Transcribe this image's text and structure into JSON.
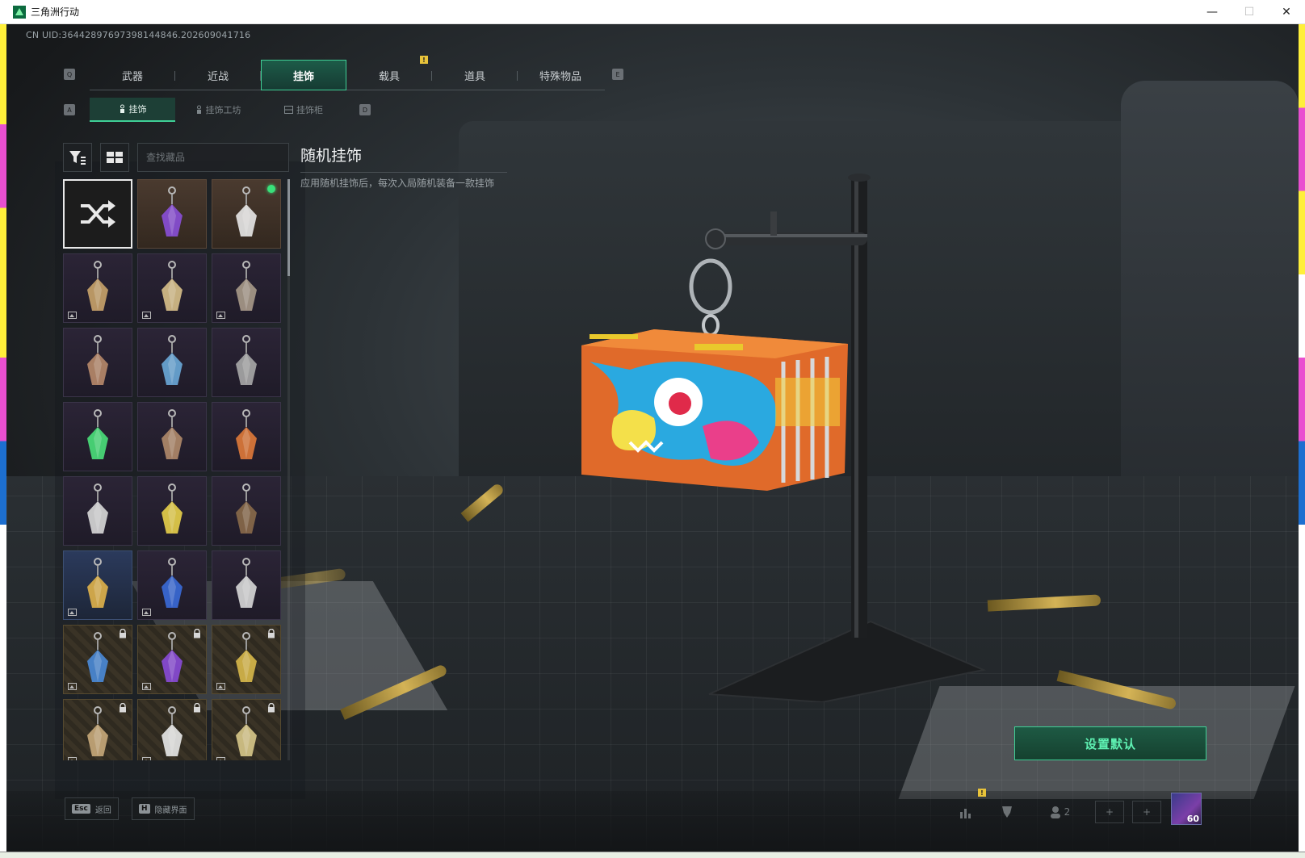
{
  "window": {
    "title": "三角洲行动"
  },
  "uid": "CN UID:36442897697398144846.202609041716",
  "main_tabs": [
    {
      "label": "武器"
    },
    {
      "label": "近战"
    },
    {
      "label": "挂饰",
      "active": true
    },
    {
      "label": "载具"
    },
    {
      "label": "道具"
    },
    {
      "label": "特殊物品"
    }
  ],
  "main_tab_keys": {
    "prev": "Q",
    "next": "E"
  },
  "sub_tabs": [
    {
      "label": "挂饰",
      "active": true
    },
    {
      "label": "挂饰工坊"
    },
    {
      "label": "挂饰柜"
    }
  ],
  "sub_tab_keys": {
    "prev": "A",
    "next": "D"
  },
  "search": {
    "placeholder": "查找藏品"
  },
  "detail": {
    "title": "随机挂饰",
    "description": "应用随机挂饰后，每次入局随机装备一款挂饰"
  },
  "set_default_label": "设置默认",
  "hints": [
    {
      "key": "Esc",
      "label": "返回"
    },
    {
      "key": "H",
      "label": "隐藏界面"
    }
  ],
  "hud": {
    "friends_count": "2",
    "level": "60"
  },
  "colors": {
    "accent": "#3fcf96",
    "accent_text": "#5ff2b3",
    "equipped_dot": "#39e07a"
  },
  "grid_items": [
    {
      "type": "random",
      "selected": true
    },
    {
      "type": "charm",
      "tier": "bronze",
      "icon": "purple-crystal-icon"
    },
    {
      "type": "charm",
      "tier": "bronze",
      "icon": "rocket-icon",
      "equipped": true
    },
    {
      "type": "charm",
      "tier": "purple",
      "icon": "hand-icon",
      "has_preview": true
    },
    {
      "type": "charm",
      "tier": "purple",
      "icon": "tag-icon",
      "has_preview": true
    },
    {
      "type": "charm",
      "tier": "purple",
      "icon": "card-icon",
      "has_preview": true
    },
    {
      "type": "charm",
      "tier": "purple",
      "icon": "boot-icon"
    },
    {
      "type": "charm",
      "tier": "purple",
      "icon": "house-icon"
    },
    {
      "type": "charm",
      "tier": "purple",
      "icon": "glove-icon"
    },
    {
      "type": "charm",
      "tier": "purple",
      "icon": "green-number-icon"
    },
    {
      "type": "charm",
      "tier": "purple",
      "icon": "frame-icon"
    },
    {
      "type": "charm",
      "tier": "purple",
      "icon": "container-icon"
    },
    {
      "type": "charm",
      "tier": "purple",
      "icon": "hat-icon"
    },
    {
      "type": "charm",
      "tier": "purple",
      "icon": "battery-icon"
    },
    {
      "type": "charm",
      "tier": "purple",
      "icon": "rifle-icon"
    },
    {
      "type": "charm",
      "tier": "blue",
      "icon": "gold-spinner-icon",
      "has_preview": true
    },
    {
      "type": "charm",
      "tier": "purple",
      "icon": "orb-icon",
      "has_preview": true
    },
    {
      "type": "charm",
      "tier": "purple",
      "icon": "figure-icon"
    },
    {
      "type": "charm",
      "tier": "gold",
      "icon": "robot-icon",
      "locked": true,
      "has_preview": true
    },
    {
      "type": "charm",
      "tier": "gold",
      "icon": "purple-coin-icon",
      "locked": true,
      "has_preview": true
    },
    {
      "type": "charm",
      "tier": "gold",
      "icon": "trophy-icon",
      "locked": true,
      "has_preview": true
    },
    {
      "type": "charm",
      "tier": "gold",
      "icon": "dragon-icon",
      "locked": true,
      "has_preview": true
    },
    {
      "type": "charm",
      "tier": "gold",
      "icon": "cloud-icon",
      "locked": true,
      "has_preview": true
    },
    {
      "type": "charm",
      "tier": "gold",
      "icon": "skull-icon",
      "locked": true,
      "has_preview": true
    }
  ]
}
